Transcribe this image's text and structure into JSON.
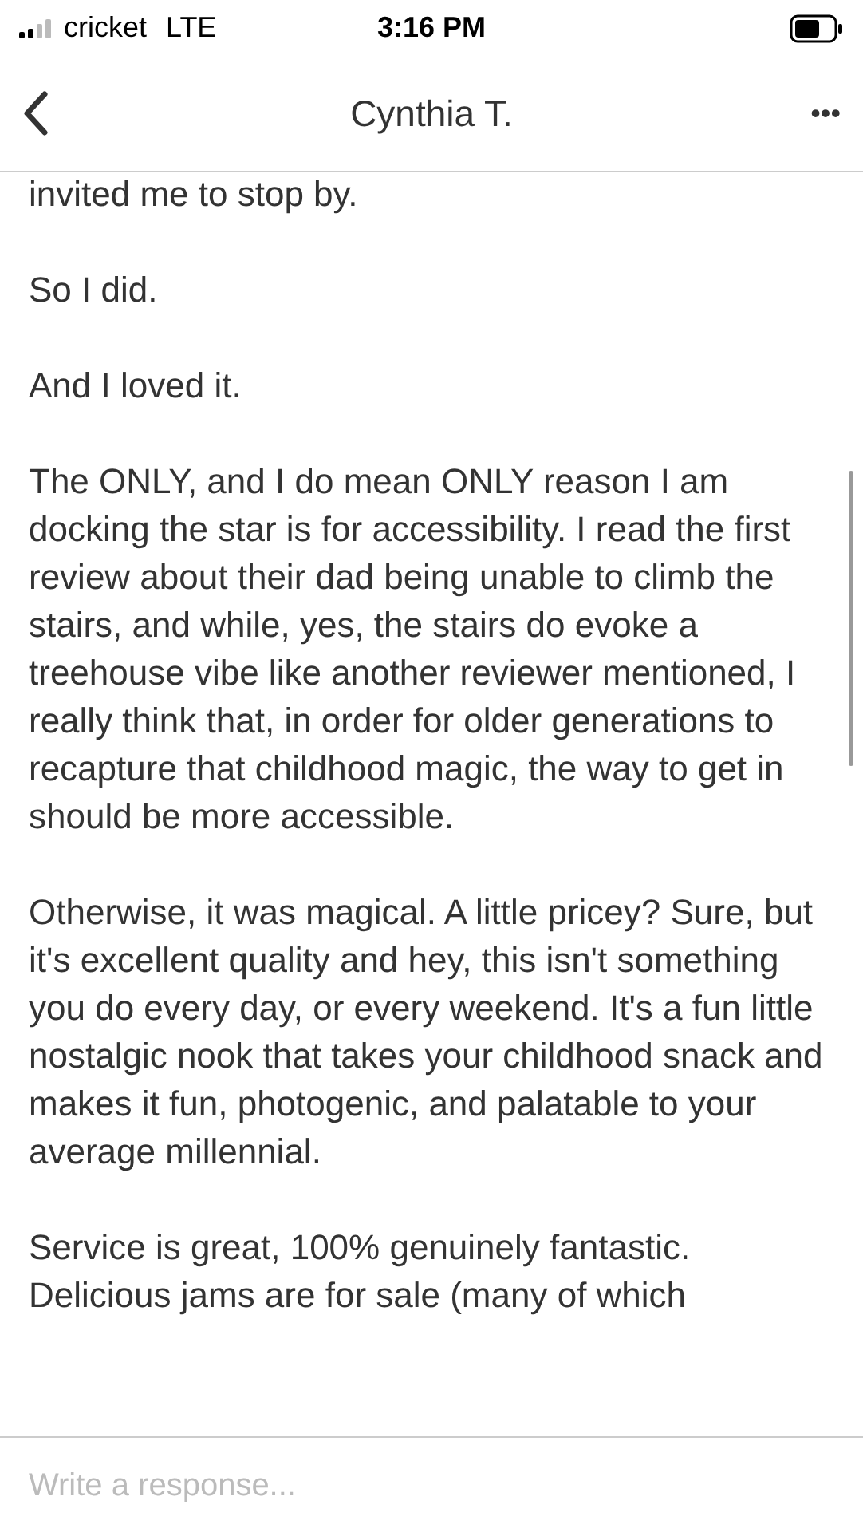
{
  "status_bar": {
    "carrier": "cricket",
    "network": "LTE",
    "time": "3:16 PM"
  },
  "header": {
    "title": "Cynthia T.",
    "more": "•••"
  },
  "paragraphs": [
    "invited me to stop by.",
    "So I did.",
    "And I loved it.",
    "The ONLY, and I do mean ONLY reason I am docking the star is for accessibility. I read the first review about their dad being unable to climb the stairs, and while, yes, the stairs do evoke a treehouse vibe like another reviewer mentioned, I really think that, in order for older generations to recapture that childhood magic, the way to get in should be more accessible.",
    "Otherwise, it was magical. A little pricey? Sure, but it's excellent quality and hey, this isn't something you do every day, or every weekend. It's a fun little nostalgic nook that takes your childhood snack and makes it fun, photogenic, and palatable to your average millennial.",
    "Service is great, 100% genuinely fantastic. Delicious jams are for sale (many of which"
  ],
  "response": {
    "placeholder": "Write a response..."
  }
}
